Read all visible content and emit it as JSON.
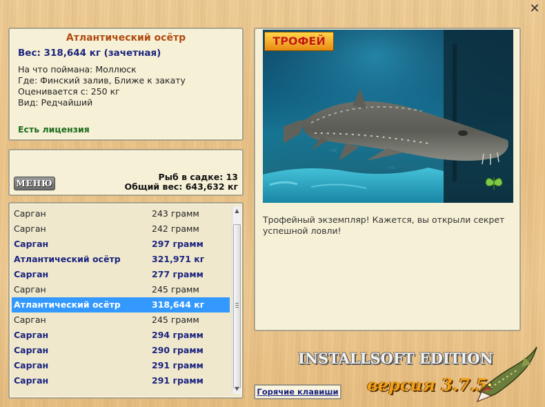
{
  "info": {
    "title": "Атлантический осётр",
    "weight": "Вес: 318,644 кг (зачетная)",
    "lines": [
      "На что поймана: Моллюск",
      "Где: Финский залив, Ближе к закату",
      "Оценивается с: 250 кг",
      "Вид: Редчайший"
    ],
    "license": "Есть лицензия"
  },
  "status": {
    "menu_label": "МЕНЮ",
    "fish_in_cage": "Рыб в садке: 13",
    "total_weight": "Общий вес: 643,632 кг"
  },
  "catch_list": [
    {
      "name": "Сарган",
      "weight": "243 грамм",
      "bold": false,
      "selected": false
    },
    {
      "name": "Сарган",
      "weight": "242 грамм",
      "bold": false,
      "selected": false
    },
    {
      "name": "Сарган",
      "weight": "297 грамм",
      "bold": true,
      "selected": false
    },
    {
      "name": "Атлантический осётр",
      "weight": "321,971 кг",
      "bold": true,
      "selected": false
    },
    {
      "name": "Сарган",
      "weight": "277 грамм",
      "bold": true,
      "selected": false
    },
    {
      "name": "Сарган",
      "weight": "245 грамм",
      "bold": false,
      "selected": false
    },
    {
      "name": "Атлантический осётр",
      "weight": "318,644 кг",
      "bold": true,
      "selected": true
    },
    {
      "name": "Сарган",
      "weight": "245 грамм",
      "bold": false,
      "selected": false
    },
    {
      "name": "Сарган",
      "weight": "294 грамм",
      "bold": true,
      "selected": false
    },
    {
      "name": "Сарган",
      "weight": "290 грамм",
      "bold": true,
      "selected": false
    },
    {
      "name": "Сарган",
      "weight": "291 грамм",
      "bold": true,
      "selected": false
    },
    {
      "name": "Сарган",
      "weight": "291 грамм",
      "bold": true,
      "selected": false
    }
  ],
  "trophy": {
    "badge": "ТРОФЕЙ",
    "text": "Трофейный экземпляр! Кажется, вы открыли секрет успешной ловли!",
    "image_subject": "sturgeon-photo"
  },
  "footer": {
    "hotkeys": "Горячие клавиши",
    "edition": "INSTALLSOFT EDITION",
    "version": "версия 3.7.5"
  },
  "colors": {
    "title": "#b04a10",
    "weight": "#1a237e",
    "license": "#1b6b1b",
    "selected_row": "#3399ff",
    "version": "#f3a21a"
  },
  "icons": {
    "close": "close-icon",
    "butterfly": "butterfly-icon",
    "logo": "pike-fish-logo"
  }
}
